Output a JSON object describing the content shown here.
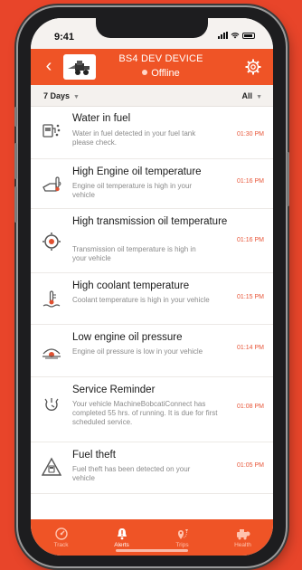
{
  "status_bar": {
    "time": "9:41"
  },
  "header": {
    "title": "BS4 DEV DEVICE",
    "status": "Offline",
    "back_icon": "back-arrow-icon",
    "settings_icon": "gear-icon"
  },
  "filters": {
    "days_label": "7 Days",
    "type_label": "All"
  },
  "alerts": [
    {
      "title": "Water in fuel",
      "description": "Water in fuel detected in your fuel tank please check.",
      "time": "01:30 PM",
      "icon": "water-in-fuel-icon"
    },
    {
      "title": "High Engine oil temperature",
      "description": "Engine oil temperature is high in your vehicle",
      "time": "01:16 PM",
      "icon": "engine-oil-temp-icon"
    },
    {
      "title": "High transmission oil temperature",
      "description": "Transmission oil temperature is high in your vehicle",
      "time": "01:16 PM",
      "icon": "transmission-temp-icon"
    },
    {
      "title": "High coolant temperature",
      "description": "Coolant temperature is high in your vehicle",
      "time": "01:15 PM",
      "icon": "coolant-temp-icon"
    },
    {
      "title": "Low engine oil pressure",
      "description": "Engine oil pressure is low in your vehicle",
      "time": "01:14 PM",
      "icon": "oil-pressure-icon"
    },
    {
      "title": "Service Reminder",
      "description": "Your vehicle MachineBobcatiConnect has completed 55 hrs. of running. It is due for first scheduled service.",
      "time": "01:08 PM",
      "icon": "service-reminder-icon"
    },
    {
      "title": "Fuel theft",
      "description": "Fuel theft has been detected on your vehicle",
      "time": "01:05 PM",
      "icon": "fuel-theft-icon"
    }
  ],
  "tabs": [
    {
      "label": "Track",
      "icon": "track-gauge-icon"
    },
    {
      "label": "Alerts",
      "icon": "alert-icon"
    },
    {
      "label": "Trips",
      "icon": "trips-pin-icon"
    },
    {
      "label": "Health",
      "icon": "health-icon"
    }
  ],
  "colors": {
    "brand": "#ef5426",
    "time_text": "#e8573a"
  }
}
